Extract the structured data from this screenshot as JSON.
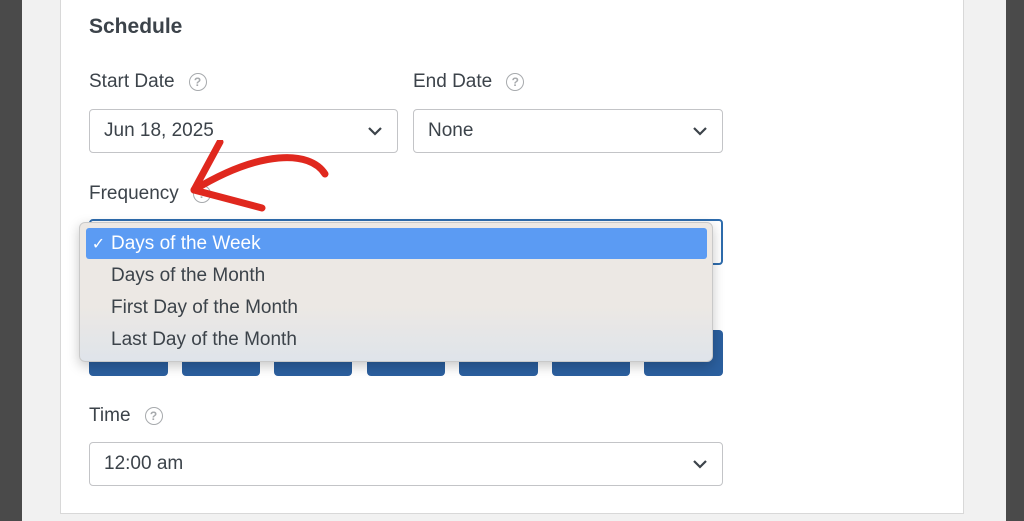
{
  "schedule": {
    "title": "Schedule",
    "start_date": {
      "label": "Start Date",
      "value": "Jun 18, 2025"
    },
    "end_date": {
      "label": "End Date",
      "value": "None"
    },
    "frequency": {
      "label": "Frequency",
      "options": [
        "Days of the Week",
        "Days of the Month",
        "First Day of the Month",
        "Last Day of the Month"
      ],
      "selected_index": 0
    },
    "time": {
      "label": "Time",
      "value": "12:00 am"
    }
  },
  "icons": {
    "help": "question-circle-icon",
    "chevron": "chevron-down-icon",
    "check": "checkmark-icon",
    "annotation": "red-arrow-annotation"
  },
  "colors": {
    "accent": "#2b5f9e",
    "highlight": "#5b9bf3",
    "annotation": "#e0281e"
  }
}
